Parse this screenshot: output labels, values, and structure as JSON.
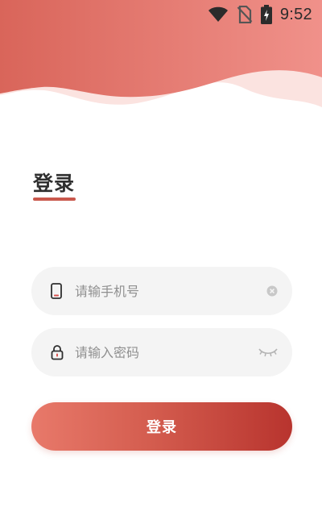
{
  "status_bar": {
    "time": "9:52",
    "icons": [
      "wifi-icon",
      "no-sim-icon",
      "battery-charging-icon"
    ]
  },
  "theme": {
    "accent": "#c9584c",
    "header_gradient_start": "#d9655a",
    "header_gradient_end": "#f0918a",
    "field_background": "#f4f4f4",
    "button_gradient_start": "#e8796a",
    "button_gradient_end": "#b8342e"
  },
  "login": {
    "title": "登录",
    "phone_field": {
      "placeholder": "请输手机号",
      "value": "",
      "lead_icon": "phone-icon",
      "trail_icon": "clear-icon"
    },
    "password_field": {
      "placeholder": "请输入密码",
      "value": "",
      "lead_icon": "lock-icon",
      "trail_icon": "eye-closed-icon"
    },
    "submit_label": "登录"
  }
}
